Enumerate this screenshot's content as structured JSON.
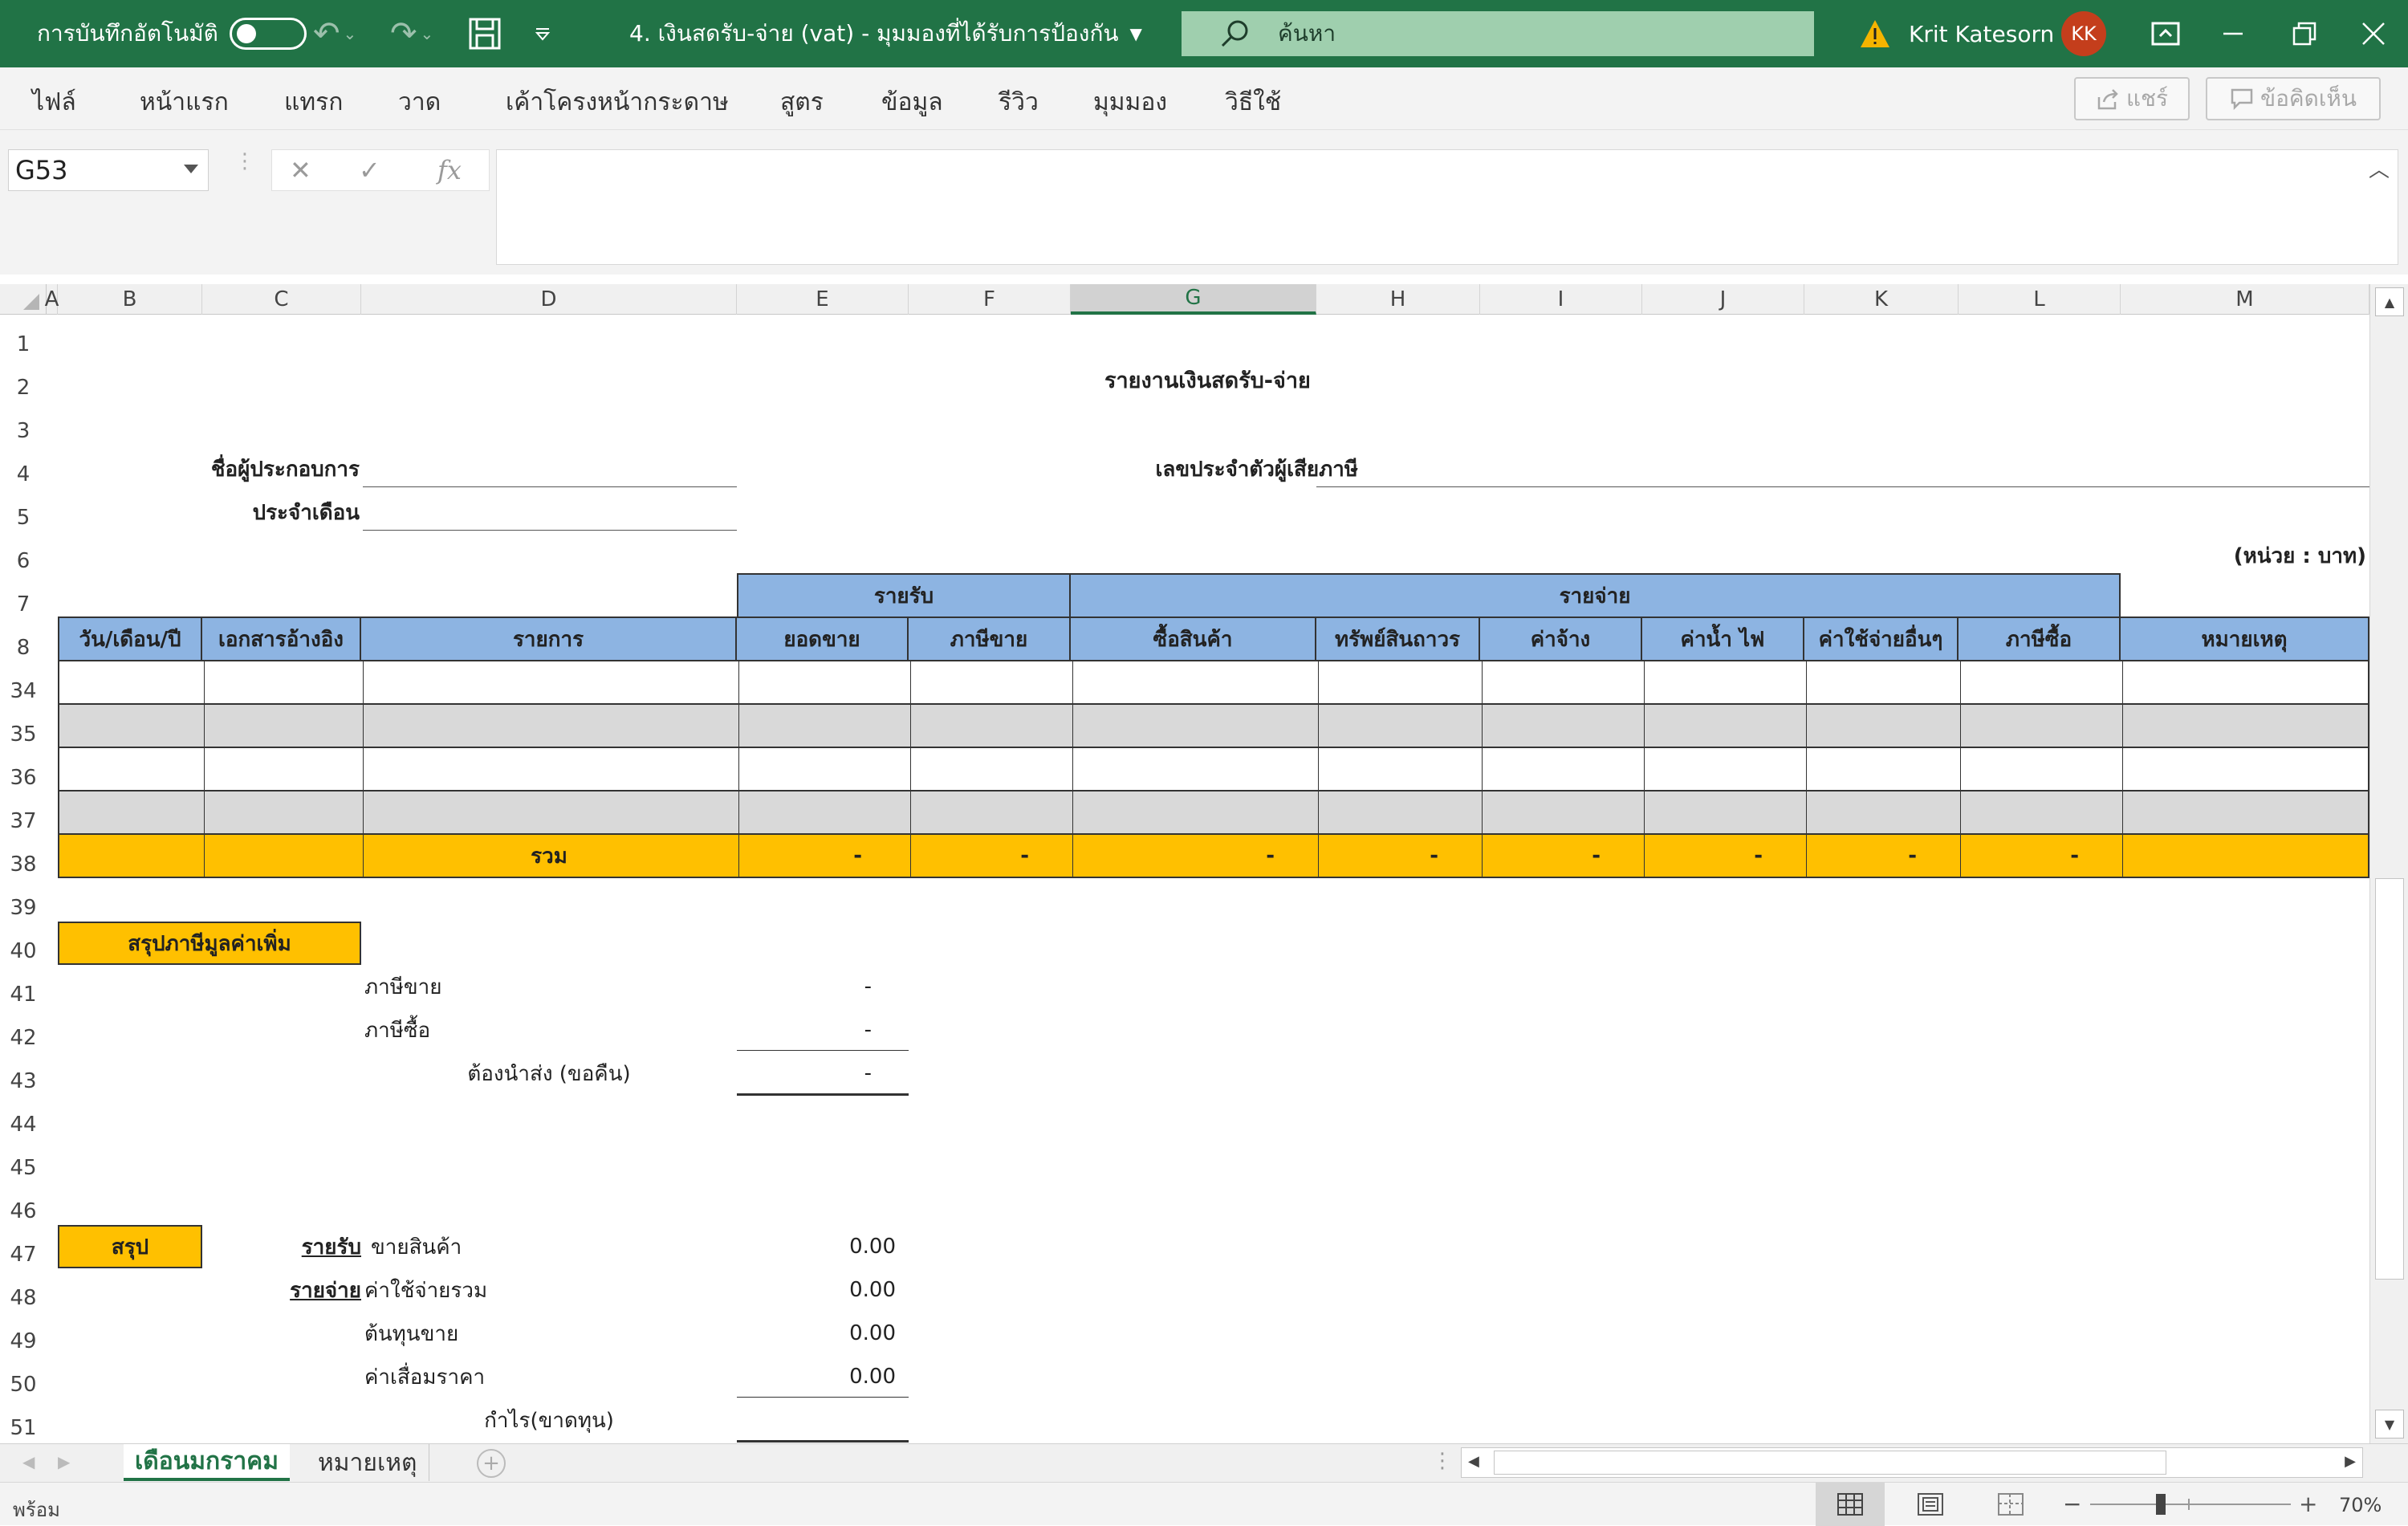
{
  "titlebar": {
    "autosave_label": "การบันทึกอัตโนมัติ",
    "doc_title": "4. เงินสดรับ-จ่าย (vat)  -  มุมมองที่ได้รับการป้องกัน",
    "search_placeholder": "ค้นหา",
    "user_name": "Krit Katesorn",
    "user_initials": "KK"
  },
  "ribbon": {
    "tabs": [
      "ไฟล์",
      "หน้าแรก",
      "แทรก",
      "วาด",
      "เค้าโครงหน้ากระดาษ",
      "สูตร",
      "ข้อมูล",
      "รีวิว",
      "มุมมอง",
      "วิธีใช้"
    ],
    "share_label": "แชร์",
    "comments_label": "ข้อคิดเห็น"
  },
  "formula_bar": {
    "name_box": "G53",
    "fx": "fx",
    "content": ""
  },
  "columns": [
    "A",
    "B",
    "C",
    "D",
    "E",
    "F",
    "G",
    "H",
    "I",
    "J",
    "K",
    "L",
    "M"
  ],
  "selected_column": "G",
  "rows": [
    "1",
    "2",
    "3",
    "4",
    "5",
    "6",
    "7",
    "8",
    "34",
    "35",
    "36",
    "37",
    "38",
    "39",
    "40",
    "41",
    "42",
    "43",
    "44",
    "45",
    "46",
    "47",
    "48",
    "49",
    "50",
    "51"
  ],
  "sheet": {
    "report_title": "รายงานเงินสดรับ-จ่าย",
    "business_name_label": "ชื่อผู้ประกอบการ",
    "tax_id_label": "เลขประจำตัวผู้เสียภาษี",
    "month_label": "ประจำเดือน",
    "unit_label": "(หน่วย : บาท)",
    "group_income": "รายรับ",
    "group_expense": "รายจ่าย",
    "headers": [
      "วัน/เดือน/ปี",
      "เอกสารอ้างอิง",
      "รายการ",
      "ยอดขาย",
      "ภาษีขาย",
      "ซื้อสินค้า",
      "ทรัพย์สินถาวร",
      "ค่าจ้าง",
      "ค่าน้ำ ไฟ",
      "ค่าใช้จ่ายอื่นๆ",
      "ภาษีซื้อ",
      "หมายเหตุ"
    ],
    "total_label": "รวม",
    "total_values": [
      "-",
      "-",
      "-",
      "-",
      "-",
      "-",
      "-",
      "-"
    ],
    "vat_summary": {
      "title": "สรุปภาษีมูลค่าเพิ่ม",
      "output_vat_label": "ภาษีขาย",
      "output_vat_value": "-",
      "input_vat_label": "ภาษีซื้อ",
      "input_vat_value": "-",
      "net_label": "ต้องนำส่ง (ขอคืน)",
      "net_value": "-"
    },
    "summary": {
      "title": "สรุป",
      "income_label": "รายรับ",
      "expense_label": "รายจ่าย",
      "sales_label": "ขายสินค้า",
      "sales_value": "0.00",
      "total_expense_label": "ค่าใช้จ่ายรวม",
      "total_expense_value": "0.00",
      "cogs_label": "ต้นทุนขาย",
      "cogs_value": "0.00",
      "depreciation_label": "ค่าเสื่อมราคา",
      "depreciation_value": "0.00",
      "profit_label": "กำไร(ขาดทุน)"
    }
  },
  "sheet_tabs": [
    "เดือนมกราคม",
    "หมายเหตุ"
  ],
  "status": {
    "ready": "พร้อม",
    "zoom": "70%"
  },
  "colors": {
    "excel_green": "#217346",
    "header_blue": "#8db4e2",
    "total_yellow": "#ffc000",
    "stripe_gray": "#d9d9d9"
  }
}
